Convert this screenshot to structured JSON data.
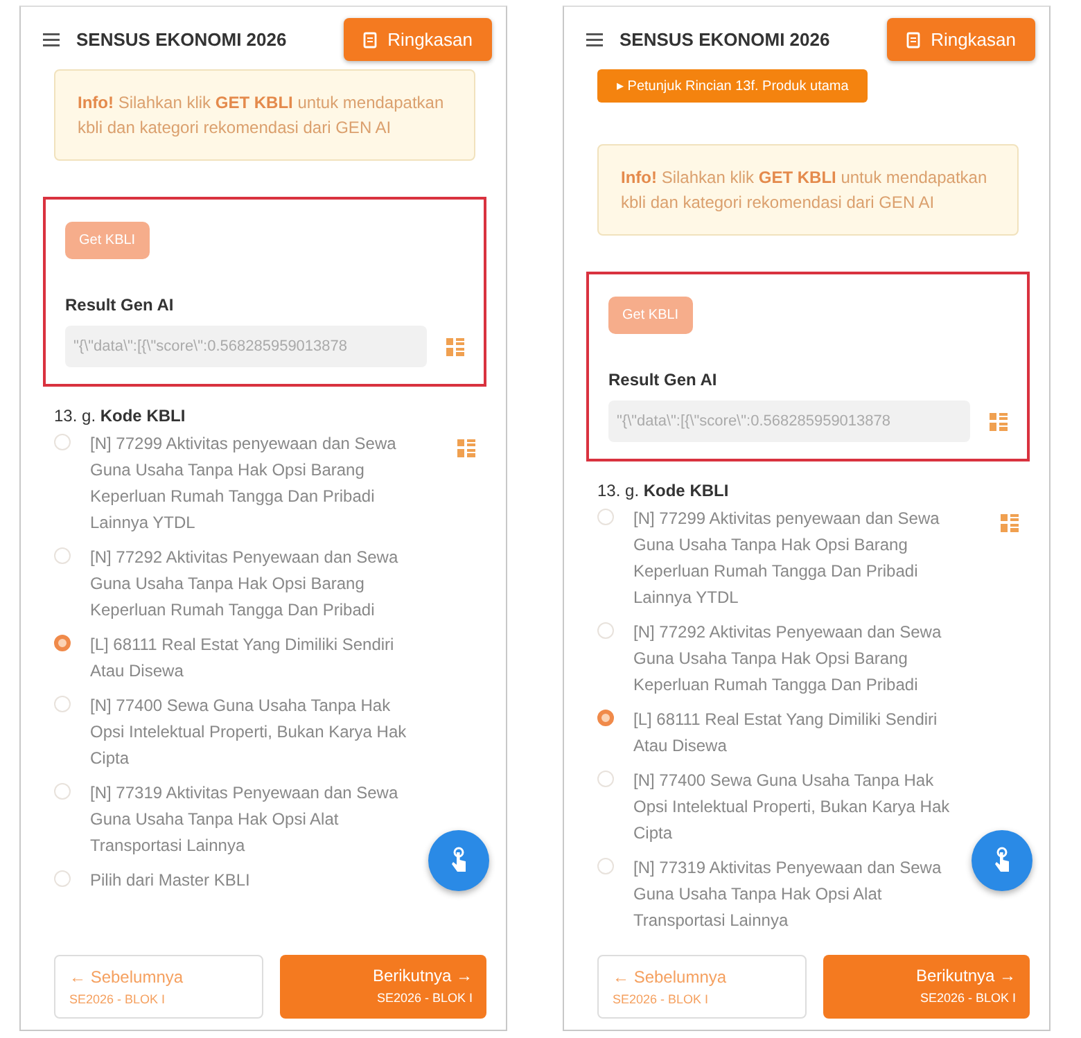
{
  "screens": [
    {
      "app_bar": {
        "title": "SENSUS EKONOMI 2026",
        "summary_button": "Ringkasan"
      },
      "info": {
        "text": "**Info!** Silahkan klik **GET KBLI** untuk mendapatkan kbli dan kategori rekomendasi dari GEN AI"
      },
      "gen_ai": {
        "highlighted": true,
        "get_button": {
          "label": "Get KBLI",
          "disabled": true
        },
        "result_label": "Result Gen AI",
        "result_value": "\"{\\\"data\\\":[{\\\"score\\\":0.568285959013878"
      },
      "question": {
        "number": "13. g.",
        "label": "Kode KBLI",
        "options": [
          {
            "text": "[N] 77299 Aktivitas penyewaan dan Sewa Guna Usaha Tanpa Hak Opsi Barang Keperluan Rumah Tangga Dan Pribadi Lainnya YTDL",
            "selected": false
          },
          {
            "text": "[N] 77292 Aktivitas Penyewaan dan Sewa Guna Usaha Tanpa Hak Opsi Barang Keperluan Rumah Tangga Dan Pribadi",
            "selected": false
          },
          {
            "text": "[L] 68111 Real Estat Yang Dimiliki Sendiri Atau Disewa",
            "selected": true
          },
          {
            "text": "[N] 77400 Sewa Guna Usaha Tanpa Hak Opsi Intelektual Properti, Bukan Karya Hak Cipta",
            "selected": false
          },
          {
            "text": "[N] 77319 Aktivitas Penyewaan dan Sewa Guna Usaha Tanpa Hak Opsi Alat Transportasi Lainnya",
            "selected": false
          },
          {
            "text": "Pilih dari Master KBLI",
            "selected": false
          }
        ]
      },
      "nav": {
        "prev": {
          "label": "← Sebelumnya",
          "sub": "SE2026 - BLOK I"
        },
        "next": {
          "label": "Berikutnya →",
          "sub": "SE2026 - BLOK I"
        }
      }
    },
    {
      "app_bar": {
        "title": "SENSUS EKONOMI 2026",
        "summary_button": "Ringkasan"
      },
      "guide_button": "▸ Petunjuk Rincian 13f. Produk utama",
      "info": {
        "text": "**Info!** Silahkan klik **GET KBLI** untuk mendapatkan kbli dan kategori rekomendasi dari GEN AI"
      },
      "gen_ai": {
        "highlighted": true,
        "get_button": {
          "label": "Get KBLI",
          "disabled": true
        },
        "result_label": "Result Gen AI",
        "result_value": "\"{\\\"data\\\":[{\\\"score\\\":0.568285959013878"
      },
      "question": {
        "number": "13. g.",
        "label": "Kode KBLI",
        "options": [
          {
            "text": "[N] 77299 Aktivitas penyewaan dan Sewa Guna Usaha Tanpa Hak Opsi Barang Keperluan Rumah Tangga Dan Pribadi Lainnya YTDL",
            "selected": false
          },
          {
            "text": "[N] 77292 Aktivitas Penyewaan dan Sewa Guna Usaha Tanpa Hak Opsi Barang Keperluan Rumah Tangga Dan Pribadi",
            "selected": false
          },
          {
            "text": "[L] 68111 Real Estat Yang Dimiliki Sendiri Atau Disewa",
            "selected": true
          },
          {
            "text": "[N] 77400 Sewa Guna Usaha Tanpa Hak Opsi Intelektual Properti, Bukan Karya Hak Cipta",
            "selected": false
          },
          {
            "text": "[N] 77319 Aktivitas Penyewaan dan Sewa Guna Usaha Tanpa Hak Opsi Alat Transportasi Lainnya",
            "selected": false
          }
        ]
      },
      "nav": {
        "prev": {
          "label": "← Sebelumnya",
          "sub": "SE2026 - BLOK I"
        },
        "next": {
          "label": "Berikutnya →",
          "sub": "SE2026 - BLOK I"
        }
      }
    }
  ]
}
